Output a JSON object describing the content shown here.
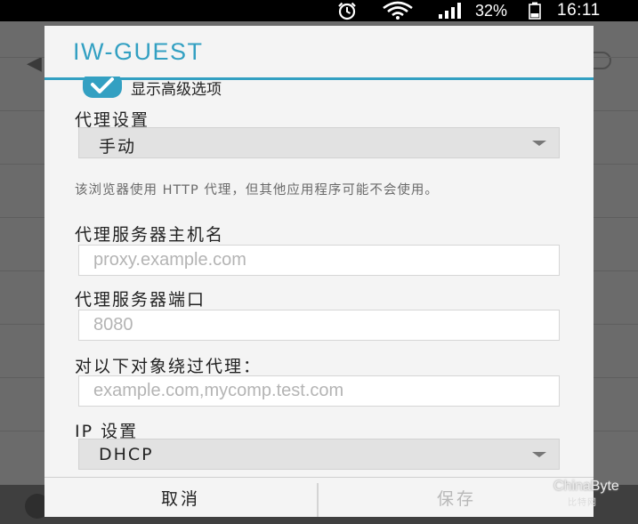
{
  "status_bar": {
    "battery_percent": "32%",
    "time": "16:11",
    "icons": [
      "alarm-icon",
      "wifi-icon",
      "signal-icon",
      "battery-icon"
    ]
  },
  "dialog": {
    "title": "IW-GUEST",
    "show_advanced": {
      "label": "显示高级选项",
      "checked": true
    },
    "proxy_settings": {
      "label": "代理设置",
      "value": "手动"
    },
    "hint": "该浏览器使用 HTTP 代理，但其他应用程序可能不会使用。",
    "proxy_host": {
      "label": "代理服务器主机名",
      "placeholder": "proxy.example.com",
      "value": ""
    },
    "proxy_port": {
      "label": "代理服务器端口",
      "placeholder": "8080",
      "value": ""
    },
    "bypass": {
      "label": "对以下对象绕过代理：",
      "placeholder": "example.com,mycomp.test.com",
      "value": ""
    },
    "ip_settings": {
      "label": "IP 设置",
      "value": "DHCP"
    },
    "buttons": {
      "cancel": "取消",
      "save": "保存",
      "save_enabled": false
    }
  },
  "watermark": {
    "main": "ChinaByte",
    "sub": "比特网"
  },
  "colors": {
    "accent": "#33a0c2",
    "dialog_bg": "#f4f4f4",
    "status_bar": "#000000"
  }
}
